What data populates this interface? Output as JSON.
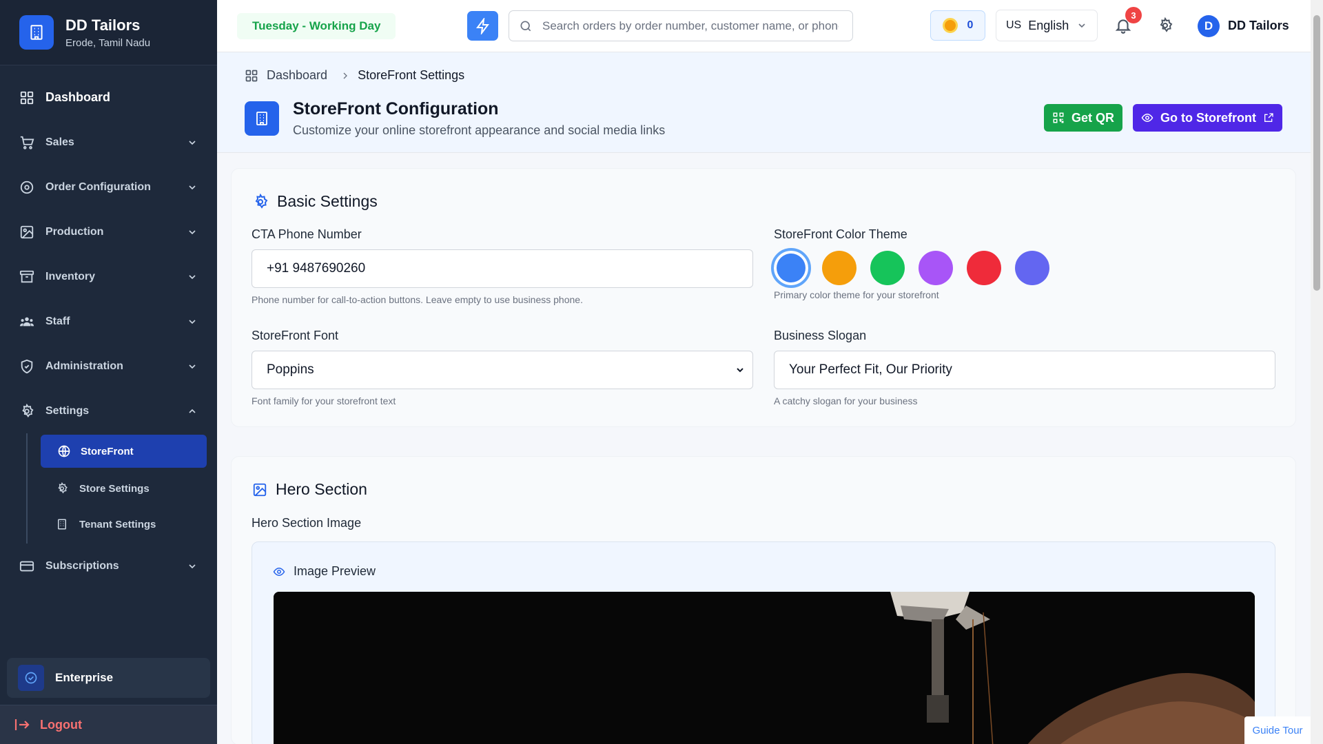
{
  "brand": {
    "name": "DD Tailors",
    "location": "Erode, Tamil Nadu"
  },
  "sidebar": {
    "items": [
      {
        "label": "Dashboard",
        "icon": "dashboard-icon"
      },
      {
        "label": "Sales",
        "icon": "cart-icon"
      },
      {
        "label": "Order Configuration",
        "icon": "gear-icon"
      },
      {
        "label": "Production",
        "icon": "image-icon"
      },
      {
        "label": "Inventory",
        "icon": "archive-icon"
      },
      {
        "label": "Staff",
        "icon": "users-icon"
      },
      {
        "label": "Administration",
        "icon": "shield-icon"
      },
      {
        "label": "Settings",
        "icon": "gear-icon"
      }
    ],
    "settings_sub": [
      {
        "label": "StoreFront",
        "icon": "globe-icon",
        "active": true
      },
      {
        "label": "Store Settings",
        "icon": "gear-icon"
      },
      {
        "label": "Tenant Settings",
        "icon": "building-icon"
      }
    ],
    "subscriptions": "Subscriptions",
    "plan": "Enterprise",
    "logout": "Logout"
  },
  "topbar": {
    "day_status": "Tuesday - Working Day",
    "search_placeholder": "Search orders by order number, customer name, or phone",
    "coins": "0",
    "lang_flag": "US",
    "language": "English",
    "notification_count": "3",
    "user_initial": "D",
    "user_name": "DD Tailors"
  },
  "breadcrumb": {
    "home": "Dashboard",
    "current": "StoreFront Settings"
  },
  "header": {
    "title": "StoreFront Configuration",
    "subtitle": "Customize your online storefront appearance and social media links",
    "qr_button": "Get QR",
    "storefront_button": "Go to Storefront"
  },
  "basic_settings": {
    "title": "Basic Settings",
    "phone_label": "CTA Phone Number",
    "phone_value": "+91 9487690260",
    "phone_hint": "Phone number for call-to-action buttons. Leave empty to use business phone.",
    "theme_label": "StoreFront Color Theme",
    "theme_hint": "Primary color theme for your storefront",
    "theme_colors": [
      "#3b82f6",
      "#f59e0b",
      "#16c45a",
      "#a855f7",
      "#ef2b3a",
      "#6366f1"
    ],
    "selected_color": "#3b82f6",
    "font_label": "StoreFront Font",
    "font_value": "Poppins",
    "font_hint": "Font family for your storefront text",
    "slogan_label": "Business Slogan",
    "slogan_value": "Your Perfect Fit, Our Priority",
    "slogan_hint": "A catchy slogan for your business"
  },
  "hero": {
    "title": "Hero Section",
    "image_label": "Hero Section Image",
    "preview_label": "Image Preview"
  },
  "guide_tour": "Guide Tour"
}
